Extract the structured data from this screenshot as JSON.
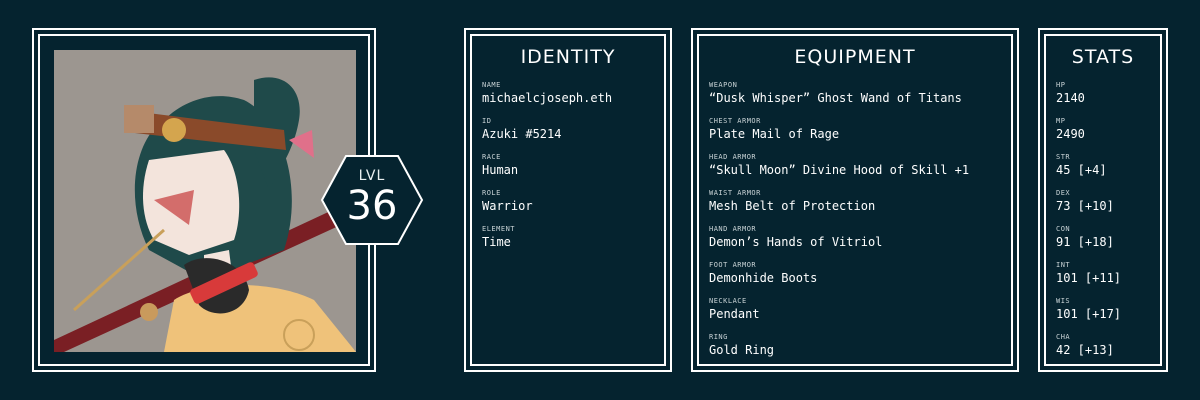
{
  "level": {
    "label": "LVL",
    "value": "36"
  },
  "identity": {
    "title": "IDENTITY",
    "items": [
      {
        "key": "NAME",
        "value": "michaelcjoseph.eth"
      },
      {
        "key": "ID",
        "value": "Azuki #5214"
      },
      {
        "key": "RACE",
        "value": "Human"
      },
      {
        "key": "ROLE",
        "value": "Warrior"
      },
      {
        "key": "ELEMENT",
        "value": "Time"
      }
    ]
  },
  "equipment": {
    "title": "EQUIPMENT",
    "items": [
      {
        "key": "WEAPON",
        "value": "“Dusk Whisper” Ghost Wand of Titans"
      },
      {
        "key": "CHEST ARMOR",
        "value": "Plate Mail of Rage"
      },
      {
        "key": "HEAD ARMOR",
        "value": "“Skull Moon” Divine Hood of Skill +1"
      },
      {
        "key": "WAIST ARMOR",
        "value": "Mesh Belt of Protection"
      },
      {
        "key": "HAND ARMOR",
        "value": "Demon’s Hands of Vitriol"
      },
      {
        "key": "FOOT ARMOR",
        "value": "Demonhide Boots"
      },
      {
        "key": "NECKLACE",
        "value": "Pendant"
      },
      {
        "key": "RING",
        "value": "Gold Ring"
      }
    ]
  },
  "stats": {
    "title": "STATS",
    "items": [
      {
        "key": "HP",
        "value": "2140"
      },
      {
        "key": "MP",
        "value": "2490"
      },
      {
        "key": "STR",
        "value": "45 [+4]"
      },
      {
        "key": "DEX",
        "value": "73 [+10]"
      },
      {
        "key": "CON",
        "value": "91 [+18]"
      },
      {
        "key": "INT",
        "value": "101 [+11]"
      },
      {
        "key": "WIS",
        "value": "101 [+17]"
      },
      {
        "key": "CHA",
        "value": "42 [+13]"
      }
    ]
  },
  "colors": {
    "background": "#05232f",
    "border": "#ffffff",
    "portrait_bg": "#9c9690"
  }
}
